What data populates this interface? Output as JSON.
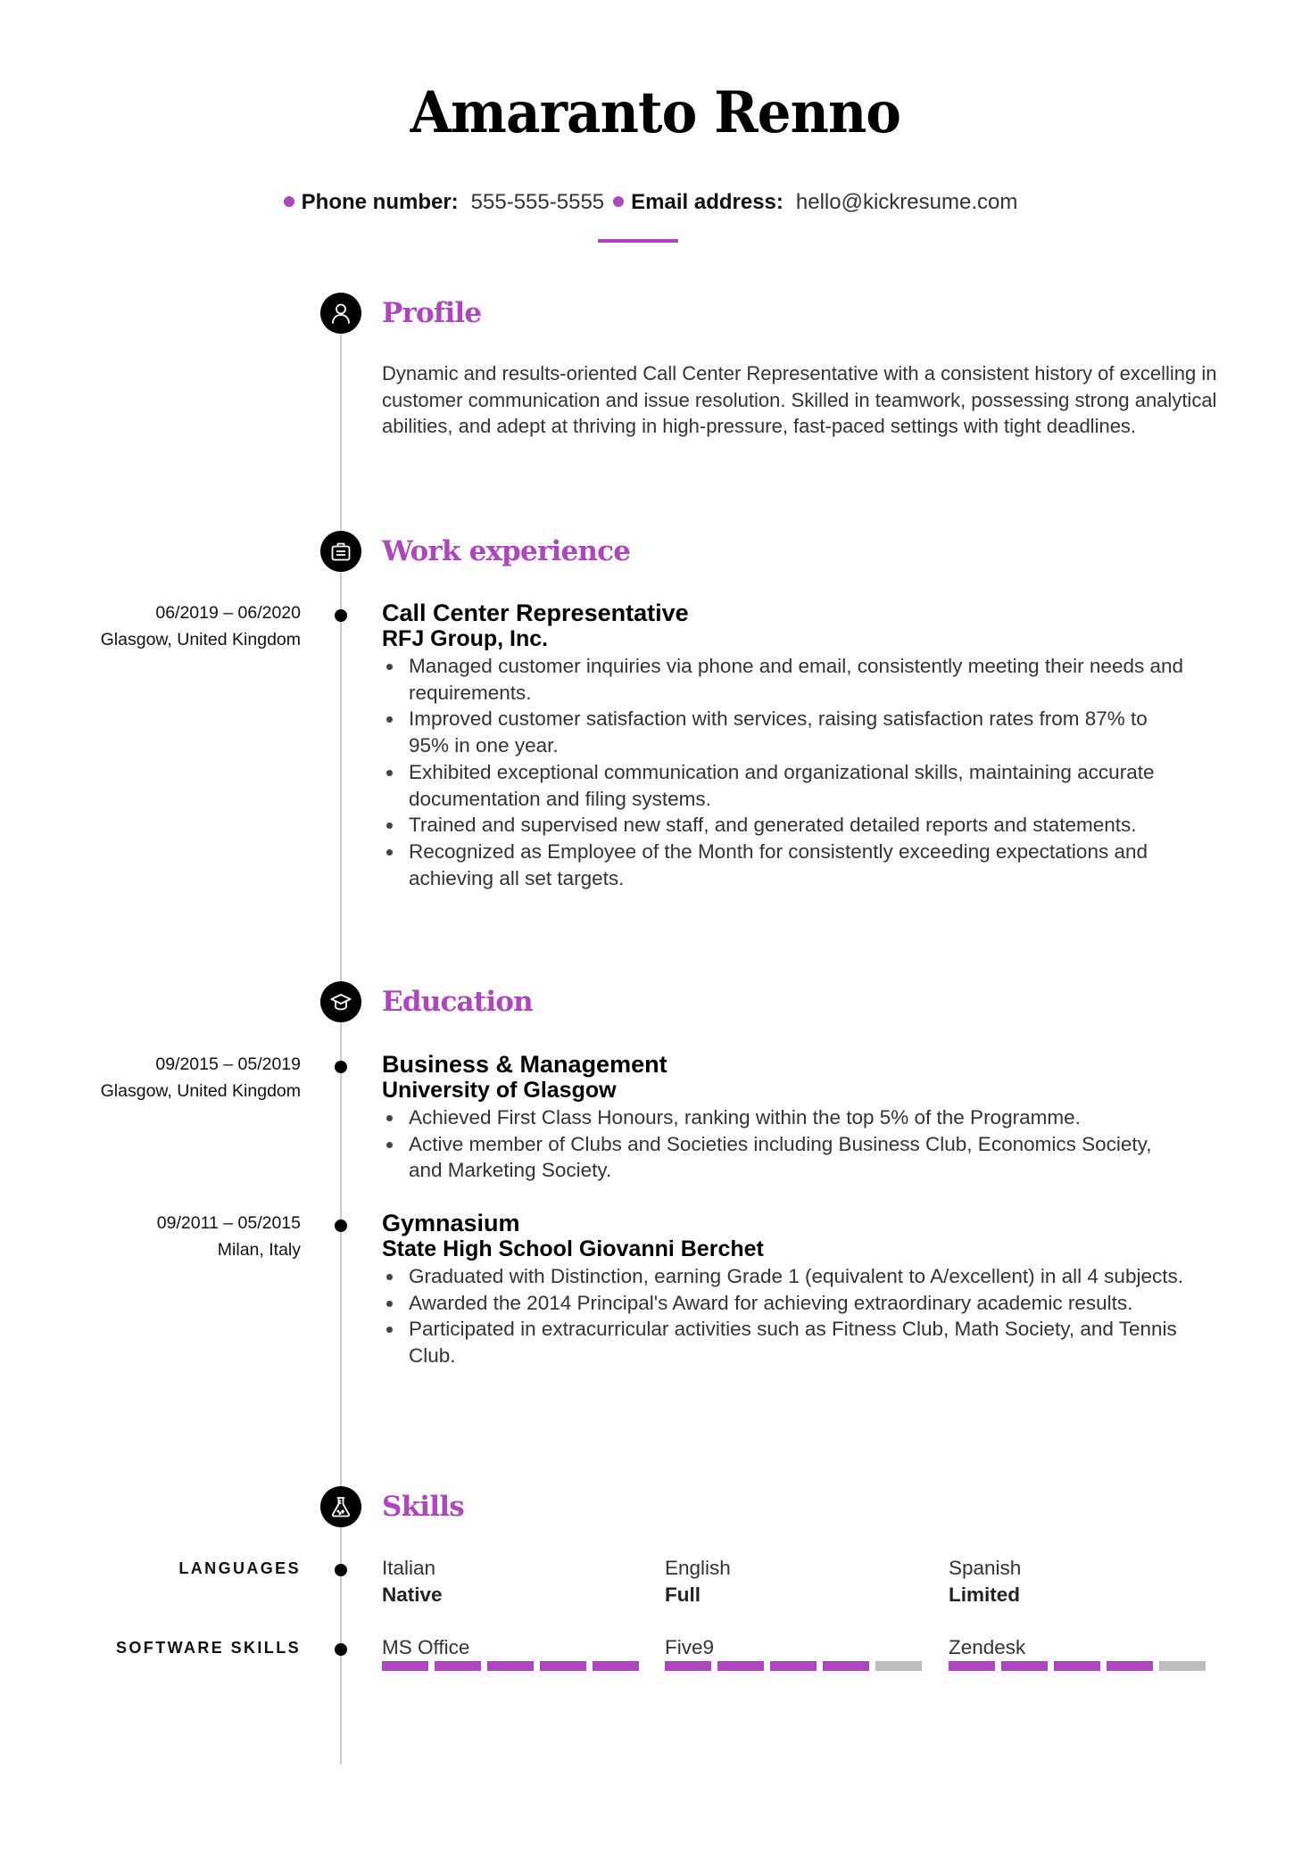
{
  "name": "Amaranto Renno",
  "contact": {
    "phone_label": "Phone number:",
    "phone_value": "555-555-5555",
    "email_label": "Email address:",
    "email_value": "hello@kickresume.com"
  },
  "colors": {
    "accent": "#ae47bd",
    "timeline": "#c8c8c8",
    "bar_empty": "#bdbdbd"
  },
  "sections": {
    "profile": {
      "title": "Profile",
      "icon": "user-icon",
      "text": "Dynamic and results-oriented Call Center Representative with a consistent history of excelling in customer communication and issue resolution. Skilled in teamwork, possessing strong analytical abilities, and adept at thriving in high-pressure, fast-paced settings with tight deadlines."
    },
    "work": {
      "title": "Work experience",
      "icon": "briefcase-icon",
      "entries": [
        {
          "dates": "06/2019 – 06/2020",
          "location": "Glasgow, United Kingdom",
          "title": "Call Center Representative",
          "org": "RFJ Group, Inc.",
          "bullets": [
            "Managed customer inquiries via phone and email, consistently meeting their needs and requirements.",
            "Improved customer satisfaction with services, raising satisfaction rates from 87% to 95% in one year.",
            "Exhibited exceptional communication and organizational skills, maintaining accurate documentation and filing systems.",
            "Trained and supervised new staff, and generated detailed reports and statements.",
            "Recognized as Employee of the Month for consistently exceeding expectations and achieving all set targets."
          ]
        }
      ]
    },
    "education": {
      "title": "Education",
      "icon": "graduation-cap-icon",
      "entries": [
        {
          "dates": "09/2015 – 05/2019",
          "location": "Glasgow, United Kingdom",
          "title": "Business & Management",
          "org": "University of Glasgow",
          "bullets": [
            "Achieved First Class Honours, ranking within the top 5% of the Programme.",
            "Active member of Clubs and Societies including Business Club, Economics Society, and Marketing Society."
          ]
        },
        {
          "dates": "09/2011 – 05/2015",
          "location": "Milan, Italy",
          "title": "Gymnasium",
          "org": "State High School Giovanni Berchet",
          "bullets": [
            "Graduated with Distinction, earning Grade 1 (equivalent to A/excellent) in all 4 subjects.",
            "Awarded the 2014 Principal's Award for achieving extraordinary academic results.",
            "Participated in extracurricular activities such as Fitness Club, Math Society, and Tennis Club."
          ]
        }
      ]
    },
    "skills": {
      "title": "Skills",
      "icon": "flask-icon",
      "languages_label": "LANGUAGES",
      "languages": [
        {
          "name": "Italian",
          "level": "Native"
        },
        {
          "name": "English",
          "level": "Full"
        },
        {
          "name": "Spanish",
          "level": "Limited"
        }
      ],
      "software_label": "SOFTWARE SKILLS",
      "software": [
        {
          "name": "MS Office",
          "rating": 5,
          "max": 5
        },
        {
          "name": "Five9",
          "rating": 4,
          "max": 5
        },
        {
          "name": "Zendesk",
          "rating": 4,
          "max": 5
        }
      ]
    }
  }
}
